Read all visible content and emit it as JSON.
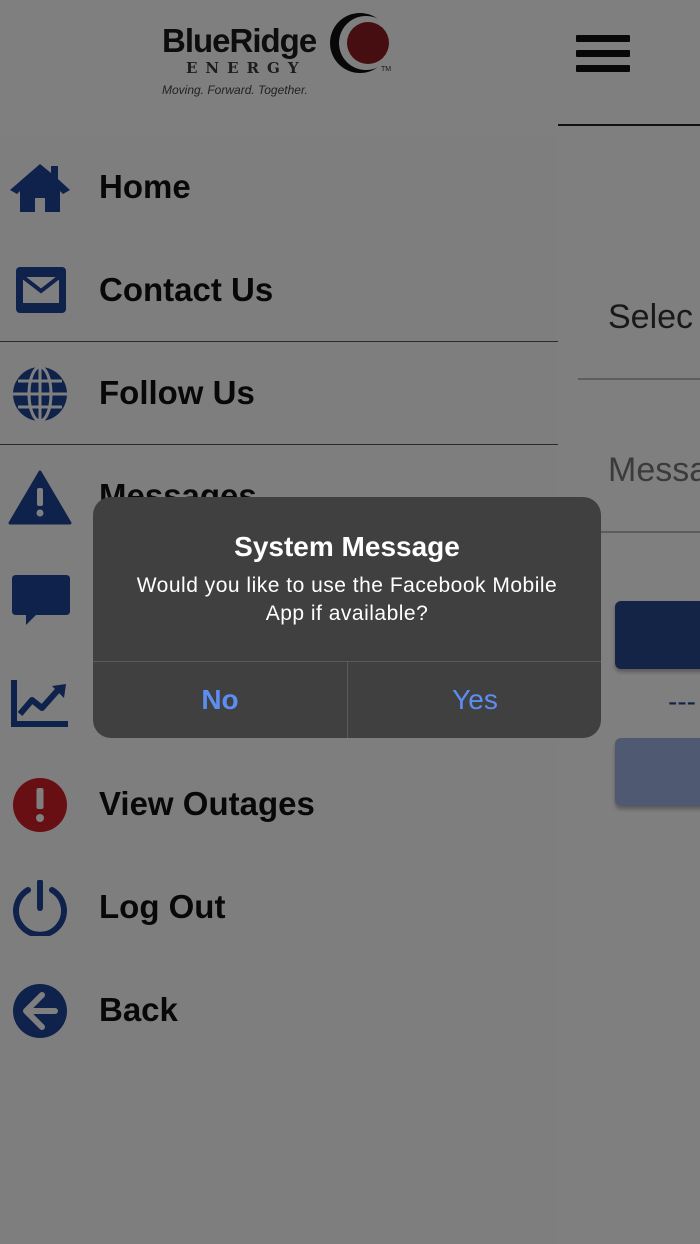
{
  "header": {
    "logo": {
      "brand": "BlueRidge",
      "sub": "ENERGY",
      "tagline": "Moving. Forward. Together.",
      "tm": "TM"
    },
    "menu_icon": "hamburger-icon"
  },
  "content": {
    "select_label": "Selec",
    "message_label": "Messa",
    "divider_text": "---"
  },
  "drawer": {
    "items": [
      {
        "label": "Home",
        "icon": "home-icon"
      },
      {
        "label": "Contact Us",
        "icon": "envelope-icon"
      },
      {
        "label": "Follow Us",
        "icon": "globe-icon"
      },
      {
        "label": "Messages",
        "icon": "warning-icon"
      },
      {
        "label": "",
        "icon": "chat-bubble-icon"
      },
      {
        "label": "",
        "icon": "chart-line-icon"
      },
      {
        "label": "View Outages",
        "icon": "exclamation-circle-icon"
      },
      {
        "label": "Log Out",
        "icon": "power-icon"
      },
      {
        "label": "Back",
        "icon": "arrow-left-circle-icon"
      }
    ]
  },
  "alert": {
    "title": "System Message",
    "message": "Would you like to use the Facebook Mobile App if available?",
    "no_label": "No",
    "yes_label": "Yes"
  },
  "colors": {
    "icon_blue": "#1f4597",
    "alert_red": "#d11f26",
    "logo_red": "#8d1d22",
    "alert_bg": "#404040",
    "alert_button": "#5c8ef2",
    "overlay": "rgba(0,0,0,0.5)"
  }
}
